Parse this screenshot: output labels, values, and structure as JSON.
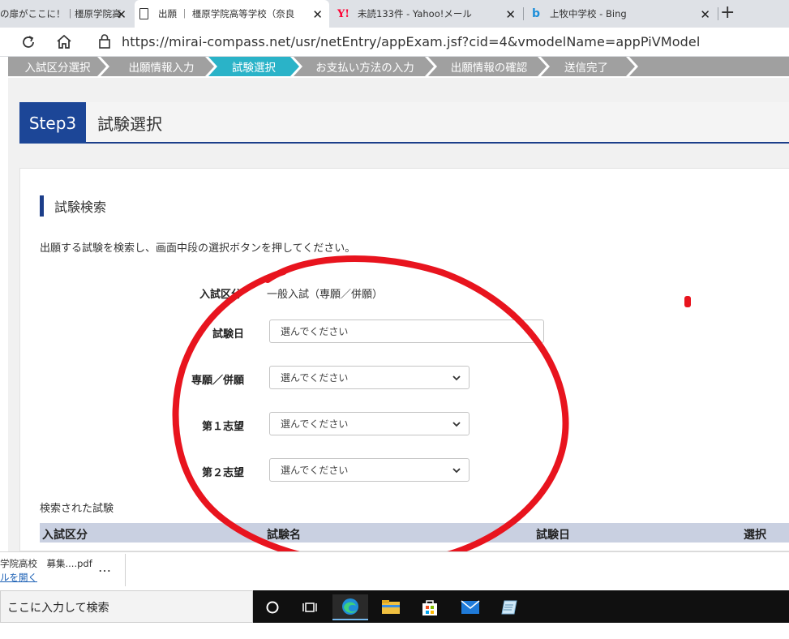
{
  "browser": {
    "tabs": [
      {
        "title": "の扉がここに！｜橿原学院高"
      },
      {
        "title": "出願 ｜ 橿原学院高等学校（奈良"
      },
      {
        "title": "未読133件 - Yahoo!メール"
      },
      {
        "title": "上牧中学校 - Bing"
      }
    ],
    "url": "https://mirai-compass.net/usr/netEntry/appExam.jsf?cid=4&vmodelName=appPiVModel"
  },
  "steps": [
    {
      "label": "入試区分選択"
    },
    {
      "label": "出願情報入力"
    },
    {
      "label": "試験選択"
    },
    {
      "label": "お支払い方法の入力"
    },
    {
      "label": "出願情報の確認"
    },
    {
      "label": "送信完了"
    }
  ],
  "page": {
    "step_label": "Step3",
    "title": "試験選択",
    "section_title": "試験検索",
    "instruction": "出願する試験を検索し、画面中段の選択ボタンを押してください。"
  },
  "form": {
    "exam_type_label": "入試区分",
    "exam_type_value": "一般入試（専願／併願）",
    "exam_date_label": "試験日",
    "exam_date_placeholder": "選んでください",
    "apply_type_label": "専願／併願",
    "apply_type_value": "選んでください",
    "first_choice_label": "第１志望",
    "first_choice_value": "選んでください",
    "second_choice_label": "第２志望",
    "second_choice_value": "選んでください"
  },
  "results": {
    "caption": "検索された試験",
    "columns": [
      "入試区分",
      "試験名",
      "試験日",
      "選択"
    ]
  },
  "download": {
    "file": "学院高校　募集....pdf",
    "open_link": "ルを開く",
    "more": "…"
  },
  "taskbar": {
    "search_placeholder": "ここに入力して検索"
  },
  "colors": {
    "step_active": "#2ab3c8",
    "step_inactive": "#a0a0a0",
    "header_blue": "#1c4697",
    "annotation_red": "#e8141e"
  }
}
